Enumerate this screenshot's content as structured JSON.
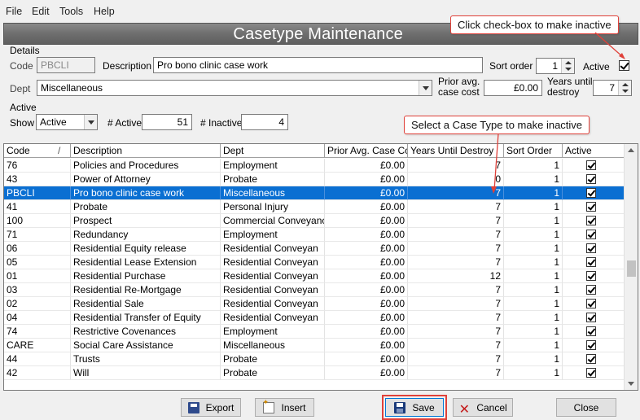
{
  "menu": {
    "file": "File",
    "edit": "Edit",
    "tools": "Tools",
    "help": "Help"
  },
  "window": {
    "title": "Casetype Maintenance"
  },
  "callouts": {
    "active_hint": "Click check-box to make inactive",
    "grid_hint": "Select a Case Type to make inactive"
  },
  "details": {
    "section_label": "Details",
    "code_label": "Code",
    "code_value": "PBCLI",
    "description_label": "Description",
    "description_value": "Pro bono clinic case work",
    "sort_order_label": "Sort order",
    "sort_order_value": "1",
    "active_label": "Active",
    "active_checked": true,
    "dept_label": "Dept",
    "dept_value": "Miscellaneous",
    "prior_cost_label_1": "Prior avg.",
    "prior_cost_label_2": "case cost",
    "prior_cost_value": "£0.00",
    "years_label_1": "Years until",
    "years_label_2": "destroy",
    "years_value": "7"
  },
  "active_filter": {
    "section_label": "Active",
    "show_label": "Show",
    "show_value": "Active",
    "num_active_label": "# Active",
    "num_active_value": "51",
    "num_inactive_label": "# Inactive",
    "num_inactive_value": "4"
  },
  "grid": {
    "headers": [
      "Code",
      "Description",
      "Dept",
      "Prior Avg. Case Cost",
      "Years Until Destroy",
      "Sort Order",
      "Active"
    ],
    "sort_indicator": "/",
    "selected_index": 2,
    "rows": [
      {
        "code": "76",
        "description": "Policies and Procedures",
        "dept": "Employment",
        "cost": "£0.00",
        "years": "7",
        "sort": "1",
        "active": true
      },
      {
        "code": "43",
        "description": "Power of Attorney",
        "dept": "Probate",
        "cost": "£0.00",
        "years": "0",
        "sort": "1",
        "active": true
      },
      {
        "code": "PBCLI",
        "description": "Pro bono clinic case work",
        "dept": "Miscellaneous",
        "cost": "£0.00",
        "years": "7",
        "sort": "1",
        "active": true
      },
      {
        "code": "41",
        "description": "Probate",
        "dept": "Personal Injury",
        "cost": "£0.00",
        "years": "7",
        "sort": "1",
        "active": true
      },
      {
        "code": "100",
        "description": "Prospect",
        "dept": "Commercial Conveyanc",
        "cost": "£0.00",
        "years": "7",
        "sort": "1",
        "active": true
      },
      {
        "code": "71",
        "description": "Redundancy",
        "dept": "Employment",
        "cost": "£0.00",
        "years": "7",
        "sort": "1",
        "active": true
      },
      {
        "code": "06",
        "description": "Residential Equity release",
        "dept": "Residential Conveyan",
        "cost": "£0.00",
        "years": "7",
        "sort": "1",
        "active": true
      },
      {
        "code": "05",
        "description": "Residential Lease Extension",
        "dept": "Residential Conveyan",
        "cost": "£0.00",
        "years": "7",
        "sort": "1",
        "active": true
      },
      {
        "code": "01",
        "description": "Residential Purchase",
        "dept": "Residential Conveyan",
        "cost": "£0.00",
        "years": "12",
        "sort": "1",
        "active": true
      },
      {
        "code": "03",
        "description": "Residential Re-Mortgage",
        "dept": "Residential Conveyan",
        "cost": "£0.00",
        "years": "7",
        "sort": "1",
        "active": true
      },
      {
        "code": "02",
        "description": "Residential Sale",
        "dept": "Residential Conveyan",
        "cost": "£0.00",
        "years": "7",
        "sort": "1",
        "active": true
      },
      {
        "code": "04",
        "description": "Residential Transfer of Equity",
        "dept": "Residential Conveyan",
        "cost": "£0.00",
        "years": "7",
        "sort": "1",
        "active": true
      },
      {
        "code": "74",
        "description": "Restrictive Covenances",
        "dept": "Employment",
        "cost": "£0.00",
        "years": "7",
        "sort": "1",
        "active": true
      },
      {
        "code": "CARE",
        "description": "Social Care Assistance",
        "dept": "Miscellaneous",
        "cost": "£0.00",
        "years": "7",
        "sort": "1",
        "active": true
      },
      {
        "code": "44",
        "description": "Trusts",
        "dept": "Probate",
        "cost": "£0.00",
        "years": "7",
        "sort": "1",
        "active": true
      },
      {
        "code": "42",
        "description": "Will",
        "dept": "Probate",
        "cost": "£0.00",
        "years": "7",
        "sort": "1",
        "active": true
      }
    ]
  },
  "buttons": {
    "export": "Export",
    "insert": "Insert",
    "save": "Save",
    "cancel": "Cancel",
    "close": "Close"
  },
  "colors": {
    "selection": "#0a6fd2",
    "callout_border": "#e0413a",
    "title_bar": "#6e6e6e"
  }
}
